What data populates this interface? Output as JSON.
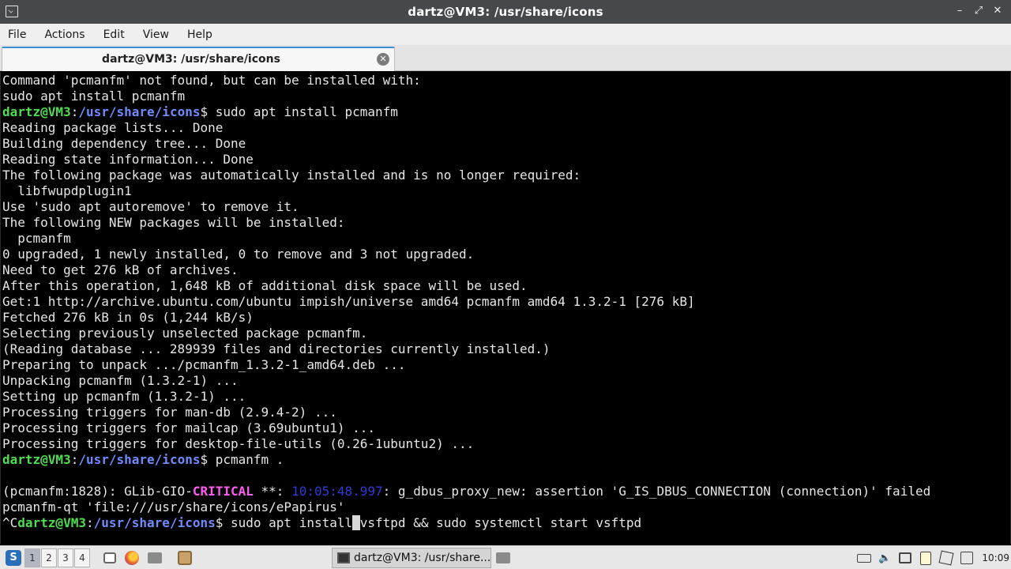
{
  "window": {
    "title": "dartz@VM3: /usr/share/icons",
    "controls": [
      "–",
      "⤢",
      "✕"
    ]
  },
  "menubar": {
    "items": [
      "File",
      "Actions",
      "Edit",
      "View",
      "Help"
    ]
  },
  "tab": {
    "label": "dartz@VM3: /usr/share/icons",
    "close_glyph": "✕"
  },
  "terminal": {
    "prompt_user": "dartz@VM3",
    "prompt_path": "/usr/share/icons",
    "lines": [
      "Command 'pcmanfm' not found, but can be installed with:",
      "sudo apt install pcmanfm",
      "__PROMPT__sudo apt install pcmanfm",
      "Reading package lists... Done",
      "Building dependency tree... Done",
      "Reading state information... Done",
      "The following package was automatically installed and is no longer required:",
      "  libfwupdplugin1",
      "Use 'sudo apt autoremove' to remove it.",
      "The following NEW packages will be installed:",
      "  pcmanfm",
      "0 upgraded, 1 newly installed, 0 to remove and 3 not upgraded.",
      "Need to get 276 kB of archives.",
      "After this operation, 1,648 kB of additional disk space will be used.",
      "Get:1 http://archive.ubuntu.com/ubuntu impish/universe amd64 pcmanfm amd64 1.3.2-1 [276 kB]",
      "Fetched 276 kB in 0s (1,244 kB/s)",
      "Selecting previously unselected package pcmanfm.",
      "(Reading database ... 289939 files and directories currently installed.)",
      "Preparing to unpack .../pcmanfm_1.3.2-1_amd64.deb ...",
      "Unpacking pcmanfm (1.3.2-1) ...",
      "Setting up pcmanfm (1.3.2-1) ...",
      "Processing triggers for man-db (2.9.4-2) ...",
      "Processing triggers for mailcap (3.69ubuntu1) ...",
      "Processing triggers for desktop-file-utils (0.26-1ubuntu2) ...",
      "__PROMPT__pcmanfm .",
      "",
      "__GLIB__",
      "pcmanfm-qt 'file:///usr/share/icons/ePapirus'",
      "__LAST__"
    ],
    "glib_line": {
      "prefix": "(pcmanfm:1828): GLib-GIO-",
      "level": "CRITICAL",
      "mid": " **: ",
      "time": "10:05:48.997",
      "msg": ": g_dbus_proxy_new: assertion 'G_IS_DBUS_CONNECTION (connection)' failed"
    },
    "last_line": {
      "interrupt": "^C",
      "command_before_cursor": "sudo apt install",
      "cursor_char": " ",
      "command_after_cursor": "vsftpd && sudo systemctl start vsftpd"
    }
  },
  "taskbar": {
    "desktops": [
      "1",
      "2",
      "3",
      "4"
    ],
    "active_desktop": "1",
    "task_label": "dartz@VM3: /usr/share...",
    "clock": "10:09",
    "colors": {
      "start": "#2a6fb8",
      "firefox": "#e8642c",
      "files": "#7a7a7a"
    }
  }
}
